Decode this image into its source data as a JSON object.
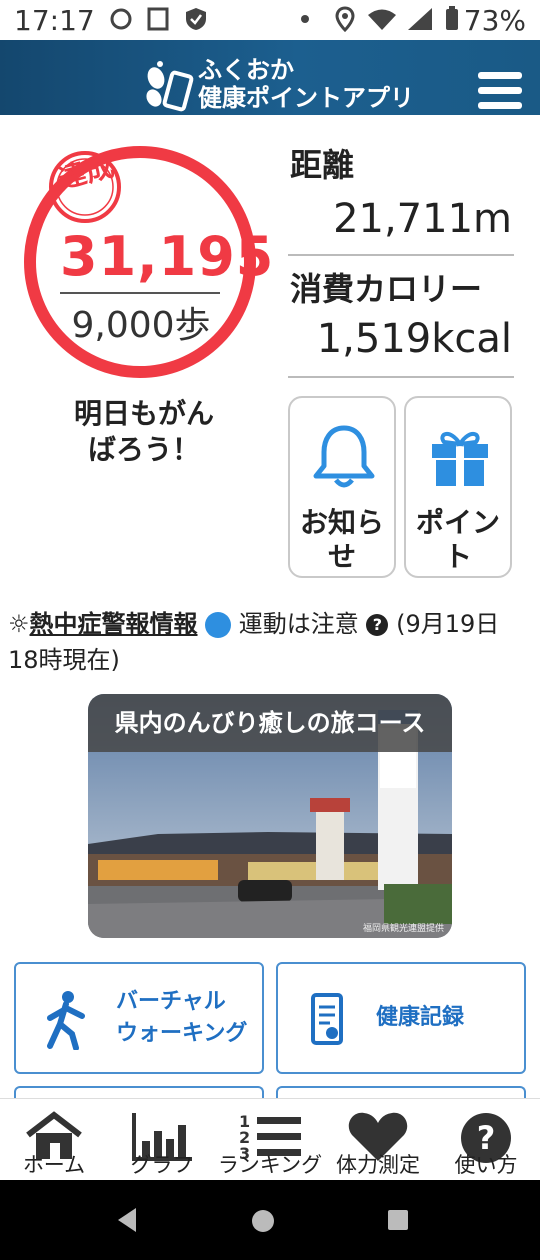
{
  "status_bar": {
    "time": "17:17",
    "battery": "73%"
  },
  "header": {
    "logo_line1": "ふくおか",
    "logo_line2": "健康ポイントアプリ"
  },
  "summary": {
    "stamp": "達成",
    "steps": "31,195",
    "goal": "9,000歩",
    "message_line1": "明日もがん",
    "message_line2": "ばろう！"
  },
  "metrics": {
    "distance_label": "距離",
    "distance_value": "21,711m",
    "calories_label": "消費カロリー",
    "calories_value": "1,519kcal"
  },
  "tiles": {
    "notice_line1": "お知ら",
    "notice_line2": "せ",
    "points_line1": "ポイン",
    "points_line2": "ト"
  },
  "heatstroke": {
    "title": "熱中症警報情報",
    "status": "運動は注意",
    "time": "(9月19日 18時現在)"
  },
  "banner": {
    "title": "県内のんびり癒しの旅コース",
    "credit": "福岡県観光連盟提供"
  },
  "buttons": {
    "virtual_walking_line1": "バーチャル",
    "virtual_walking_line2": "ウォーキング",
    "health_record": "健康記録"
  },
  "bottom_nav": [
    {
      "label": "ホーム"
    },
    {
      "label": "グラフ"
    },
    {
      "label": "ランキング"
    },
    {
      "label": "体力測定"
    },
    {
      "label": "使い方"
    }
  ],
  "colors": {
    "accent_red": "#f03a44",
    "accent_blue": "#1f6fc2",
    "header": "#1c5f8f"
  }
}
